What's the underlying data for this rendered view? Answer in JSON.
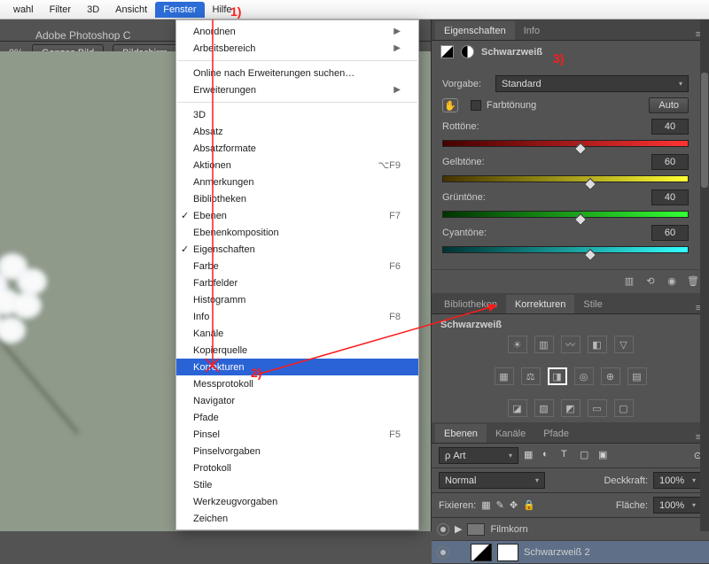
{
  "menubar": {
    "items": [
      "wahl",
      "Filter",
      "3D",
      "Ansicht",
      "Fenster",
      "Hilfe"
    ],
    "active": "Fenster"
  },
  "app_title": "Adobe Photoshop C",
  "toolbar": {
    "zoom": "0%",
    "btn1": "Ganzes Bild",
    "btn2": "Bildschirm"
  },
  "dropdown": {
    "items": [
      {
        "label": "Anordnen",
        "sub": true
      },
      {
        "label": "Arbeitsbereich",
        "sub": true
      },
      {
        "sep": true
      },
      {
        "label": "Online nach Erweiterungen suchen…"
      },
      {
        "label": "Erweiterungen",
        "sub": true
      },
      {
        "sep": true
      },
      {
        "label": "3D"
      },
      {
        "label": "Absatz"
      },
      {
        "label": "Absatzformate"
      },
      {
        "label": "Aktionen",
        "sc": "⌥F9"
      },
      {
        "label": "Anmerkungen"
      },
      {
        "label": "Bibliotheken"
      },
      {
        "label": "Ebenen",
        "chk": true,
        "sc": "F7"
      },
      {
        "label": "Ebenenkomposition"
      },
      {
        "label": "Eigenschaften",
        "chk": true
      },
      {
        "label": "Farbe",
        "sc": "F6"
      },
      {
        "label": "Farbfelder"
      },
      {
        "label": "Histogramm"
      },
      {
        "label": "Info",
        "sc": "F8"
      },
      {
        "label": "Kanäle"
      },
      {
        "label": "Kopierquelle"
      },
      {
        "label": "Korrekturen",
        "hl": true
      },
      {
        "label": "Messprotokoll"
      },
      {
        "label": "Navigator"
      },
      {
        "label": "Pfade"
      },
      {
        "label": "Pinsel",
        "sc": "F5"
      },
      {
        "label": "Pinselvorgaben"
      },
      {
        "label": "Protokoll"
      },
      {
        "label": "Stile"
      },
      {
        "label": "Werkzeugvorgaben"
      },
      {
        "label": "Zeichen"
      }
    ]
  },
  "props": {
    "tab1": "Eigenschaften",
    "tab2": "Info",
    "title": "Schwarzweiß",
    "preset_l": "Vorgabe:",
    "preset_v": "Standard",
    "tint": "Farbtönung",
    "auto": "Auto",
    "s": [
      {
        "l": "Rottöne:",
        "v": "40",
        "pct": 56,
        "grad": "linear-gradient(90deg,#400,#f33)"
      },
      {
        "l": "Gelbtöne:",
        "v": "60",
        "pct": 60,
        "grad": "linear-gradient(90deg,#430,#ff3)"
      },
      {
        "l": "Grüntöne:",
        "v": "40",
        "pct": 56,
        "grad": "linear-gradient(90deg,#030,#3f3)"
      },
      {
        "l": "Cyantöne:",
        "v": "60",
        "pct": 60,
        "grad": "linear-gradient(90deg,#033,#3ff)"
      }
    ]
  },
  "korr": {
    "tabs": [
      "Bibliotheken",
      "Korrekturen",
      "Stile"
    ],
    "title": "Schwarzweiß"
  },
  "layers": {
    "tabs": [
      "Ebenen",
      "Kanäle",
      "Pfade"
    ],
    "filter": "Art",
    "blend": "Normal",
    "opacity_l": "Deckkraft:",
    "opacity_v": "100%",
    "lock_l": "Fixieren:",
    "fill_l": "Fläche:",
    "fill_v": "100%",
    "rows": [
      {
        "name": "Filmkorn",
        "group": true
      },
      {
        "name": "Schwarzweiß 2",
        "bw": true
      }
    ]
  },
  "annots": {
    "a1": "1)",
    "a2": "2)",
    "a3": "3)"
  }
}
